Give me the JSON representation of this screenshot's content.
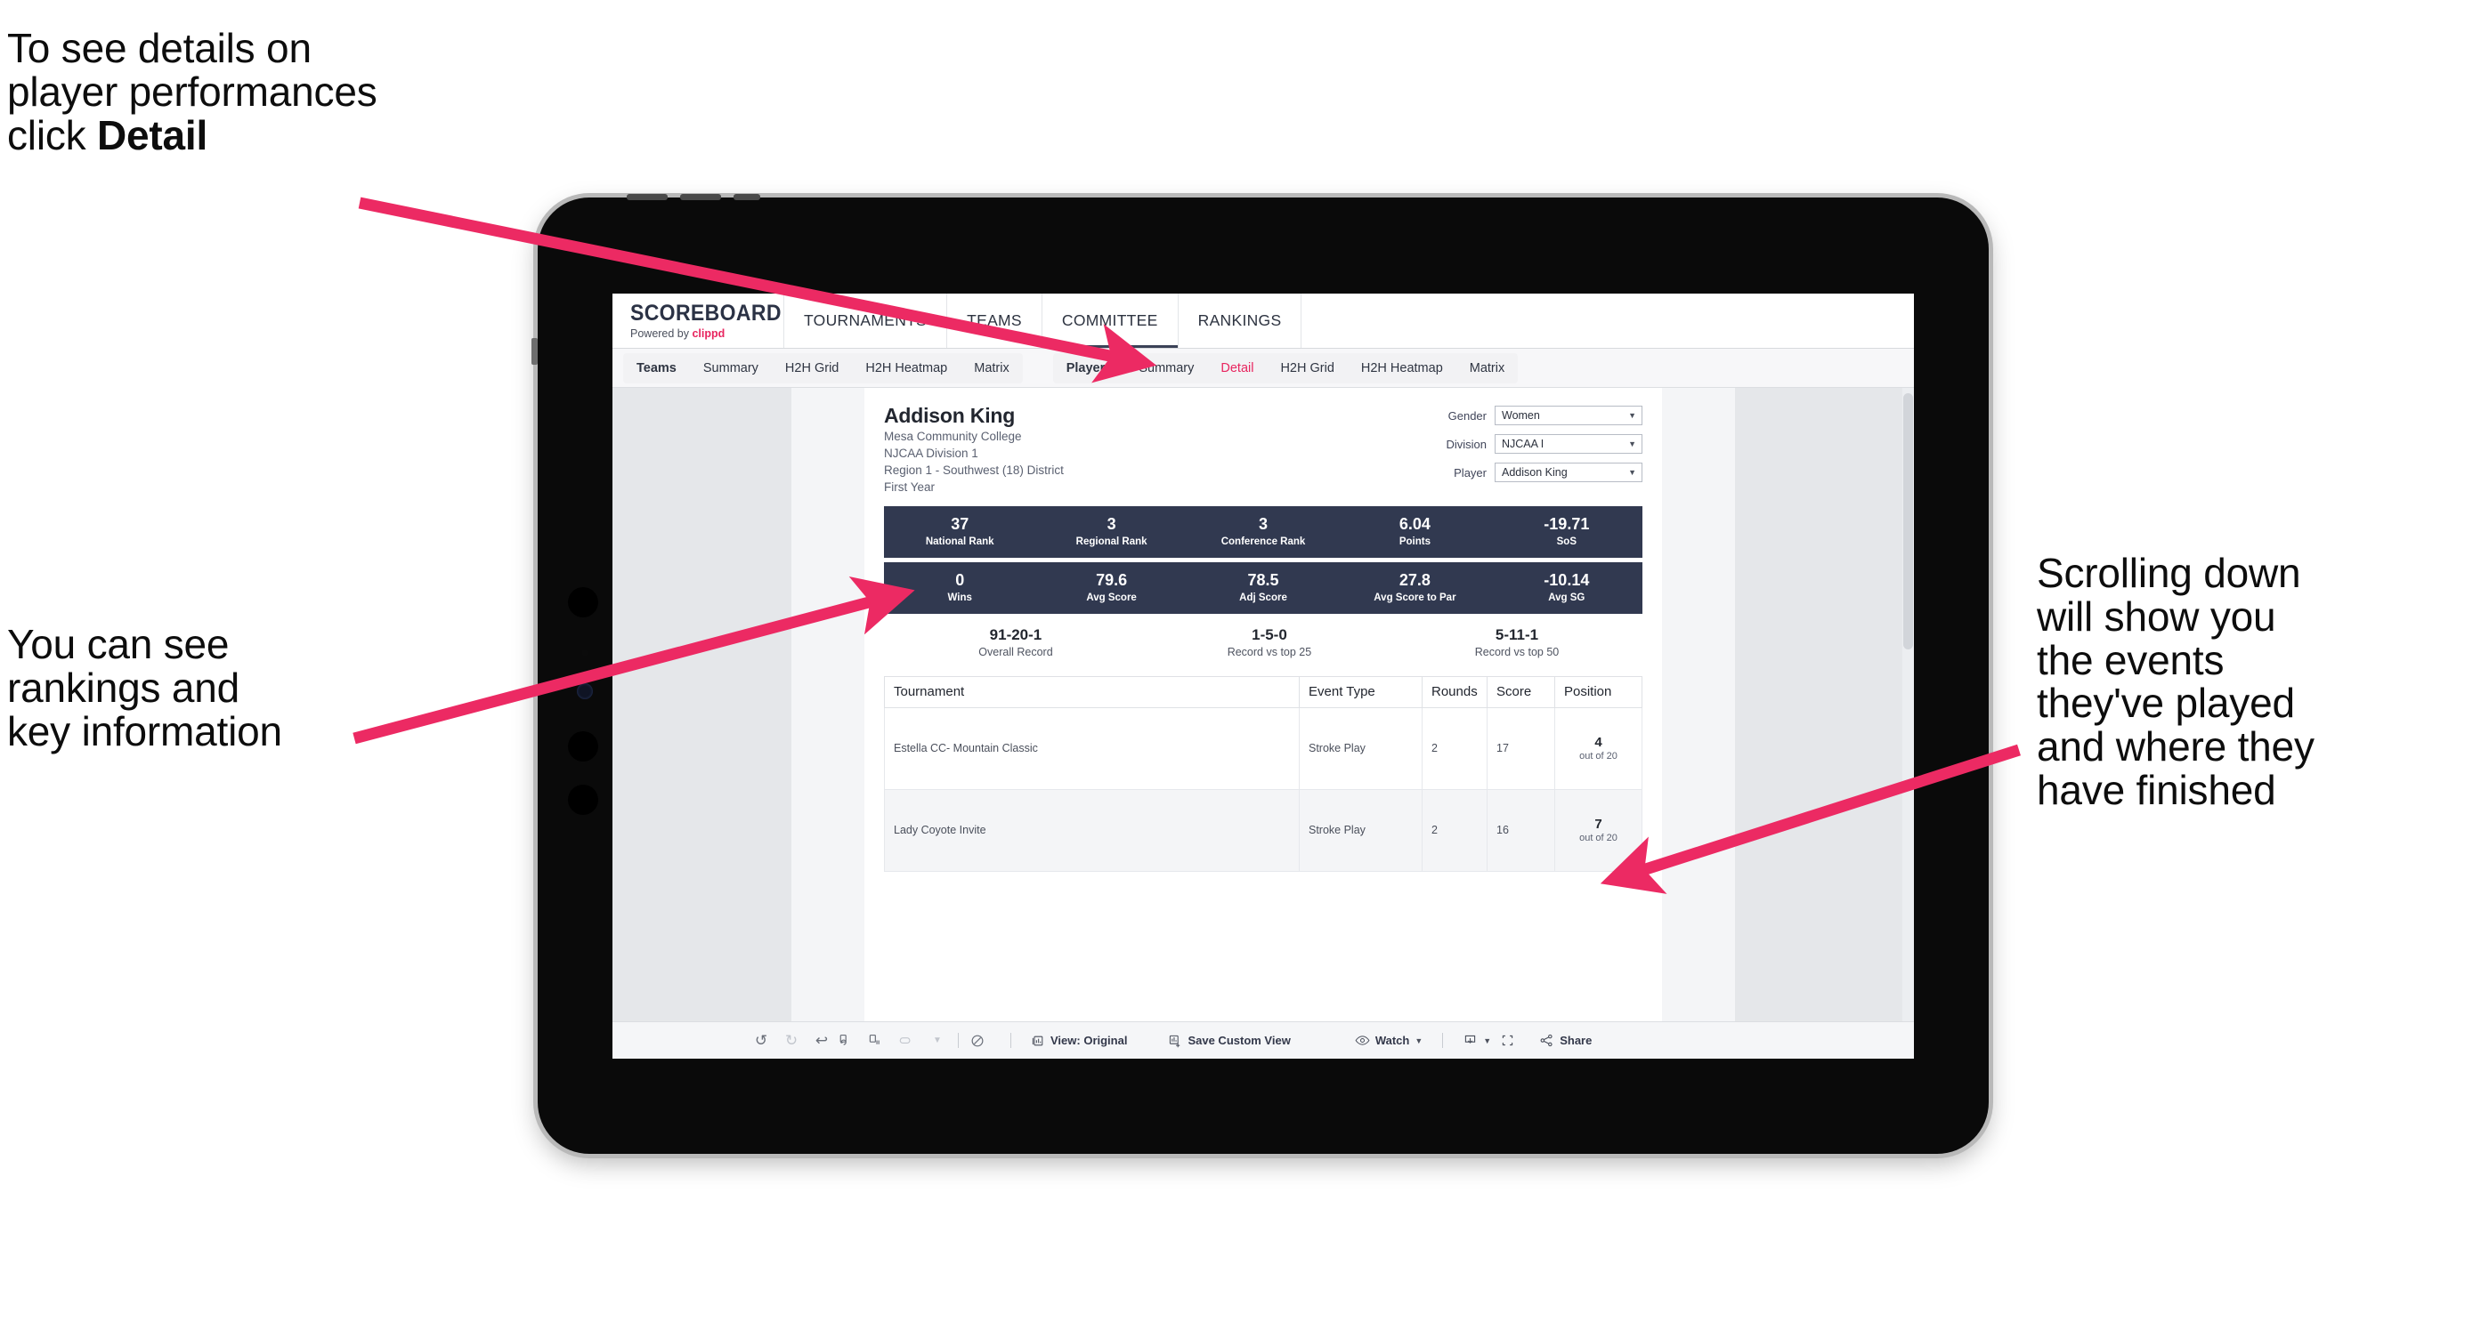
{
  "annotations": {
    "detail_note": "To see details on\nplayer performances\nclick ",
    "detail_note_bold": "Detail",
    "rankings_note": "You can see\nrankings and\nkey information",
    "scroll_note": "Scrolling down\nwill show you\nthe events\nthey've played\nand where they\nhave finished",
    "arrow_color": "#ec2a63"
  },
  "app": {
    "brand_title": "SCOREBOARD",
    "brand_sub_prefix": "Powered by ",
    "brand_sub_name": "clippd",
    "topnav": [
      {
        "label": "TOURNAMENTS",
        "active": false
      },
      {
        "label": "TEAMS",
        "active": false
      },
      {
        "label": "COMMITTEE",
        "active": true
      },
      {
        "label": "RANKINGS",
        "active": false
      }
    ],
    "tabs_teams": [
      {
        "label": "Teams",
        "lead": true
      },
      {
        "label": "Summary"
      },
      {
        "label": "H2H Grid"
      },
      {
        "label": "H2H Heatmap"
      },
      {
        "label": "Matrix"
      }
    ],
    "tabs_players": [
      {
        "label": "Players",
        "lead": true
      },
      {
        "label": "Summary"
      },
      {
        "label": "Detail",
        "active": true
      },
      {
        "label": "H2H Grid"
      },
      {
        "label": "H2H Heatmap"
      },
      {
        "label": "Matrix"
      }
    ],
    "accent_pink": "#e8255f",
    "navy": "#313950"
  },
  "player": {
    "name": "Addison King",
    "school": "Mesa Community College",
    "division": "NJCAA Division 1",
    "region": "Region 1 - Southwest (18) District",
    "class_year": "First Year"
  },
  "filters": [
    {
      "label": "Gender",
      "value": "Women"
    },
    {
      "label": "Division",
      "value": "NJCAA I"
    },
    {
      "label": "Player",
      "value": "Addison King"
    }
  ],
  "stats_row1": [
    {
      "value": "37",
      "label": "National Rank"
    },
    {
      "value": "3",
      "label": "Regional Rank"
    },
    {
      "value": "3",
      "label": "Conference Rank"
    },
    {
      "value": "6.04",
      "label": "Points"
    },
    {
      "value": "-19.71",
      "label": "SoS"
    }
  ],
  "stats_row2": [
    {
      "value": "0",
      "label": "Wins"
    },
    {
      "value": "79.6",
      "label": "Avg Score"
    },
    {
      "value": "78.5",
      "label": "Adj Score"
    },
    {
      "value": "27.8",
      "label": "Avg Score to Par"
    },
    {
      "value": "-10.14",
      "label": "Avg SG"
    }
  ],
  "records": [
    {
      "value": "91-20-1",
      "label": "Overall Record"
    },
    {
      "value": "1-5-0",
      "label": "Record vs top 25"
    },
    {
      "value": "5-11-1",
      "label": "Record vs top 50"
    }
  ],
  "events_table": {
    "headers": [
      "Tournament",
      "Event Type",
      "Rounds",
      "Score",
      "Position"
    ],
    "rows": [
      {
        "tournament": "Estella CC- Mountain Classic",
        "event_type": "Stroke Play",
        "rounds": "2",
        "score": "17",
        "position_num": "4",
        "position_sub": "out of 20"
      },
      {
        "tournament": "Lady Coyote Invite",
        "event_type": "Stroke Play",
        "rounds": "2",
        "score": "16",
        "position_num": "7",
        "position_sub": "out of 20"
      }
    ]
  },
  "toolbar": {
    "view_label": "View: Original",
    "save_label": "Save Custom View",
    "watch_label": "Watch",
    "share_label": "Share",
    "icons": [
      "undo-icon",
      "redo-icon",
      "revert-icon",
      "refresh-icon",
      "pause-icon",
      "loop-icon",
      "chevron-down-icon",
      "alert-icon",
      "view-icon",
      "save-view-icon",
      "eye-icon",
      "download-icon",
      "fullscreen-icon",
      "share-icon"
    ]
  }
}
